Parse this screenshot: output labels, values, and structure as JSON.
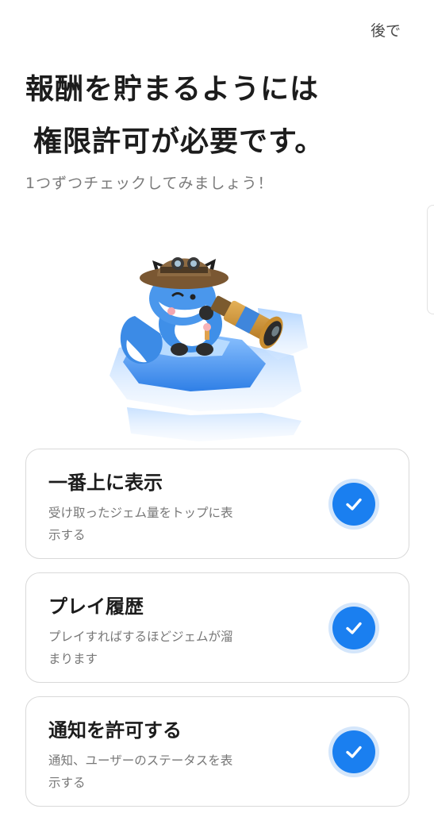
{
  "header": {
    "later_label": "後で"
  },
  "intro": {
    "title_line1": "報酬を貯まるようには",
    "title_line2": "権限許可が必要です。",
    "subtitle": "1つずつチェックしてみましょう！"
  },
  "illustration": {
    "subject": "fox-mascot-with-telescope"
  },
  "permissions": [
    {
      "title": "一番上に表示",
      "desc_line1": "受け取ったジェム量をトップに表",
      "desc_line2": "示する",
      "checked": true,
      "icon": "checkmark-icon"
    },
    {
      "title": "プレイ履歴",
      "desc_line1": "プレイすればするほどジェムが溜",
      "desc_line2": "まります",
      "checked": true,
      "icon": "checkmark-icon"
    },
    {
      "title": "通知を許可する",
      "desc_line1": "通知、ユーザーのステータスを表",
      "desc_line2": "示する",
      "checked": true,
      "icon": "checkmark-icon"
    }
  ],
  "colors": {
    "accent": "#1a7ff0",
    "accent_ring": "#d4e6fb",
    "card_border": "#d9d9d9",
    "title_text": "#1c1c1c",
    "secondary_text": "#777777"
  }
}
